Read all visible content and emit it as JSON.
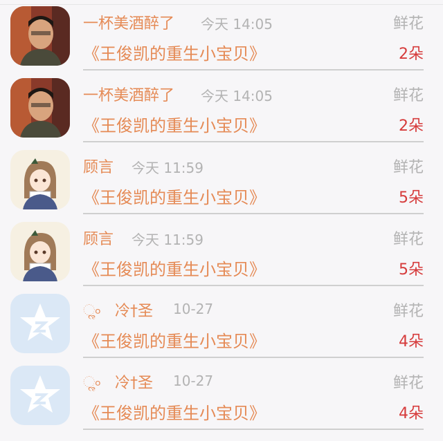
{
  "rows": [
    {
      "avatar": "man-photo",
      "prefix": "",
      "name": "一杯美酒醉了",
      "time": "今天 14:05",
      "gift_type": "鲜花",
      "book": "《王俊凯的重生小宝贝》",
      "count": "2朵"
    },
    {
      "avatar": "man-photo",
      "prefix": "",
      "name": "一杯美酒醉了",
      "time": "今天 14:05",
      "gift_type": "鲜花",
      "book": "《王俊凯的重生小宝贝》",
      "count": "2朵"
    },
    {
      "avatar": "anime-girl",
      "prefix": "",
      "name": "顾言",
      "time": "今天 11:59",
      "gift_type": "鲜花",
      "book": "《王俊凯的重生小宝贝》",
      "count": "5朵"
    },
    {
      "avatar": "anime-girl",
      "prefix": "",
      "name": "顾言",
      "time": "今天 11:59",
      "gift_type": "鲜花",
      "book": "《王俊凯的重生小宝贝》",
      "count": "5朵"
    },
    {
      "avatar": "qzone-star",
      "prefix": "ૢ৹",
      "name": "冷†圣",
      "time": "10-27",
      "gift_type": "鲜花",
      "book": "《王俊凯的重生小宝贝》",
      "count": "4朵"
    },
    {
      "avatar": "qzone-star",
      "prefix": "ૢ৹",
      "name": "冷†圣",
      "time": "10-27",
      "gift_type": "鲜花",
      "book": "《王俊凯的重生小宝贝》",
      "count": "4朵"
    }
  ],
  "colors": {
    "accent": "#e58a55",
    "count": "#d63b3b",
    "muted": "#b3b3b3",
    "background": "#f7f6f8"
  }
}
